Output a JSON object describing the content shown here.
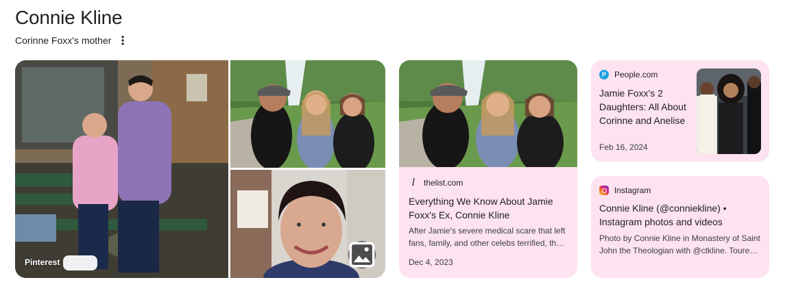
{
  "header": {
    "title": "Connie Kline",
    "subtitle": "Corinne Foxx's mother"
  },
  "gallery": {
    "main_image_source": "Pinterest"
  },
  "cards": {
    "thelist": {
      "source": "thelist.com",
      "title": "Everything We Know About Jamie Foxx's Ex, Connie Kline",
      "snippet": "After Jamie's severe medical scare that left fans, family, and other celebs terrified, th…",
      "date": "Dec 4, 2023"
    },
    "people": {
      "source": "People.com",
      "title": "Jamie Foxx's 2 Daughters: All About Corinne and Anelise",
      "date": "Feb 16, 2024"
    },
    "instagram": {
      "source": "Instagram",
      "title": "Connie Kline (@conniekline) • Instagram photos and videos",
      "snippet": "Photo by Connie Kline in Monastery of Saint John the Theologian with @ctkline. Toure…"
    }
  },
  "icons": {
    "more": "more-vert-icon",
    "image_search": "image-search-icon",
    "thelist": "thelist-logo-icon",
    "people": "people-logo-icon",
    "instagram": "instagram-logo-icon"
  },
  "colors": {
    "card_background": "#fde2ef",
    "people_brand": "#1a9fe0"
  }
}
